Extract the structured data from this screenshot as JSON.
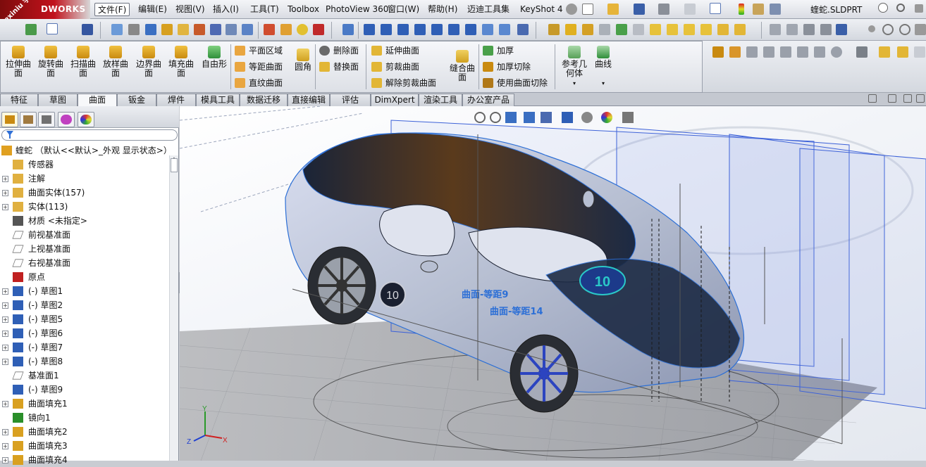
{
  "app": {
    "logo_text": "DWORKS",
    "watermark": "xuexiniu 学犀牛中文网",
    "document_title": "蝰蛇.SLDPRT"
  },
  "menu": [
    "文件(F)",
    "编辑(E)",
    "视图(V)",
    "插入(I)",
    "工具(T)",
    "Toolbox",
    "PhotoView 360",
    "窗口(W)",
    "帮助(H)",
    "迈迪工具集",
    "KeyShot 4"
  ],
  "ribbon": {
    "large_buttons": [
      "拉伸曲\n面",
      "旋转曲\n面",
      "扫描曲\n面",
      "放样曲\n面",
      "边界曲\n面",
      "填充曲\n面",
      "自由形"
    ],
    "col1": [
      "平面区域",
      "等距曲面",
      "直纹曲面"
    ],
    "fillet": "圆角",
    "col2": [
      "删除面",
      "替换面"
    ],
    "col3": [
      "延伸曲面",
      "剪裁曲面",
      "解除剪裁曲面"
    ],
    "knit": "缝合曲\n面",
    "col4": [
      "加厚",
      "加厚切除",
      "使用曲面切除"
    ],
    "ref_geometry": "参考几\n何体",
    "curves": "曲线"
  },
  "tabs": [
    "特征",
    "草图",
    "曲面",
    "钣金",
    "焊件",
    "模具工具",
    "数据迁移",
    "直接编辑",
    "评估",
    "DimXpert",
    "渲染工具",
    "办公室产品"
  ],
  "active_tab": "曲面",
  "tree": {
    "root": "蝰蛇 （默认<<默认>_外观 显示状态>）",
    "items": [
      {
        "label": "传感器",
        "icon": "sensor-icon",
        "expand": false
      },
      {
        "label": "注解",
        "icon": "annotation-icon",
        "expand": true
      },
      {
        "label": "曲面实体(157)",
        "icon": "surface-body-folder-icon",
        "expand": true
      },
      {
        "label": "实体(113)",
        "icon": "solid-body-folder-icon",
        "expand": true
      },
      {
        "label": "材质 <未指定>",
        "icon": "material-icon",
        "expand": false
      },
      {
        "label": "前视基准面",
        "icon": "plane-icon",
        "expand": false
      },
      {
        "label": "上视基准面",
        "icon": "plane-icon",
        "expand": false
      },
      {
        "label": "右视基准面",
        "icon": "plane-icon",
        "expand": false
      },
      {
        "label": "原点",
        "icon": "origin-icon",
        "expand": false
      },
      {
        "label": "(-) 草图1",
        "icon": "sketch-icon",
        "expand": true
      },
      {
        "label": "(-) 草图2",
        "icon": "sketch-icon",
        "expand": true
      },
      {
        "label": "(-) 草图5",
        "icon": "sketch-icon",
        "expand": true
      },
      {
        "label": "(-) 草图6",
        "icon": "sketch-icon",
        "expand": true
      },
      {
        "label": "(-) 草图7",
        "icon": "sketch-icon",
        "expand": true
      },
      {
        "label": "(-) 草图8",
        "icon": "sketch-icon",
        "expand": true
      },
      {
        "label": "基准面1",
        "icon": "plane-icon",
        "expand": false
      },
      {
        "label": "(-) 草图9",
        "icon": "sketch-icon",
        "expand": false
      },
      {
        "label": "曲面填充1",
        "icon": "surface-fill-icon",
        "expand": true
      },
      {
        "label": "镜向1",
        "icon": "mirror-icon",
        "expand": false
      },
      {
        "label": "曲面填充2",
        "icon": "surface-fill-icon",
        "expand": true
      },
      {
        "label": "曲面填充3",
        "icon": "surface-fill-icon",
        "expand": true
      },
      {
        "label": "曲面填充4",
        "icon": "surface-fill-icon",
        "expand": true
      }
    ]
  },
  "viewport": {
    "car_number": "10",
    "labels": [
      "曲面-等距9",
      "曲面-等距14"
    ],
    "axes": [
      "X",
      "Y",
      "Z"
    ]
  },
  "colors": {
    "brand_red": "#c1121c",
    "selection_blue": "#2c6fd6",
    "car_dark": "#1c2a44",
    "car_body": "#b7bfd2",
    "grid": "#8e9096"
  }
}
